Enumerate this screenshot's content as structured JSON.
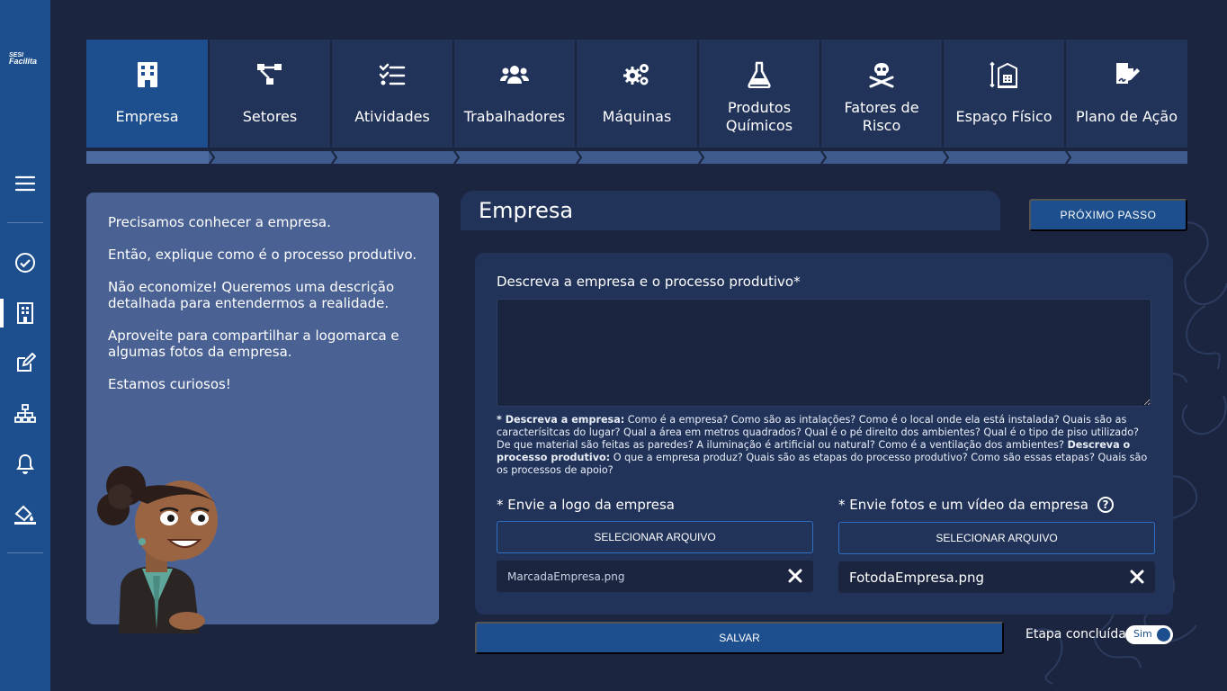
{
  "brand": {
    "line1": "SESI",
    "line2": "Facilita"
  },
  "tabs": [
    {
      "label": "Empresa",
      "icon": "building-icon",
      "active": true
    },
    {
      "label": "Setores",
      "icon": "sitemap-icon"
    },
    {
      "label": "Atividades",
      "icon": "checklist-icon"
    },
    {
      "label": "Trabalhadores",
      "icon": "users-icon"
    },
    {
      "label": "Máquinas",
      "icon": "gears-icon"
    },
    {
      "label": "Produtos Químicos",
      "icon": "flask-icon"
    },
    {
      "label": "Fatores de Risco",
      "icon": "skull-crossbones-icon"
    },
    {
      "label": "Espaço Físico",
      "icon": "building-measure-icon"
    },
    {
      "label": "Plano de Ação",
      "icon": "file-signature-icon"
    }
  ],
  "info": {
    "p1": "Precisamos conhecer a empresa.",
    "p2": "Então, explique como é o processo produtivo.",
    "p3": "Não economize! Queremos uma descrição detalhada para entendermos a realidade.",
    "p4": "Aproveite para compartilhar a logomarca e algumas fotos da empresa.",
    "p5": "Estamos curiosos!"
  },
  "main": {
    "title": "Empresa",
    "next_button": "PRÓXIMO PASSO",
    "desc_label": "Descreva a empresa e o processo produtivo*",
    "desc_value": "",
    "hint": {
      "b1": "* Descreva a empresa:",
      "t1": " Como é a empresa? Como são as intalações? Como é o local onde ela está instalada? Quais são as caracterísitcas do lugar? Qual a área em metros quadrados? Qual é o pé direito dos ambientes? Qual é o tipo de piso utilizado? De que material são feitas as paredes? A iluminação é artificial ou natural? Como é a ventilação dos ambientes? ",
      "b2": "Descreva o processo produtivo:",
      "t2": " O que a empresa produz? Quais são as etapas do processo produtivo? Como são essas etapas? Quais são os processos de apoio?"
    },
    "logo_label": "* Envie a logo da empresa",
    "photos_label": "* Envie fotos e um vídeo da empresa",
    "select_file": "SELECIONAR ARQUIVO",
    "logo_file": "MarcadaEmpresa.png",
    "photo_file": "FotodaEmpresa.png",
    "save_button": "SALVAR",
    "done_label": "Etapa concluída",
    "toggle_value": "Sim"
  },
  "colors": {
    "background": "#1b2540",
    "sidebar": "#1d4f8e",
    "tab": "#22335a",
    "tab_active": "#1d4f8e",
    "info_panel": "#4a6194",
    "button": "#1d4f8e"
  }
}
